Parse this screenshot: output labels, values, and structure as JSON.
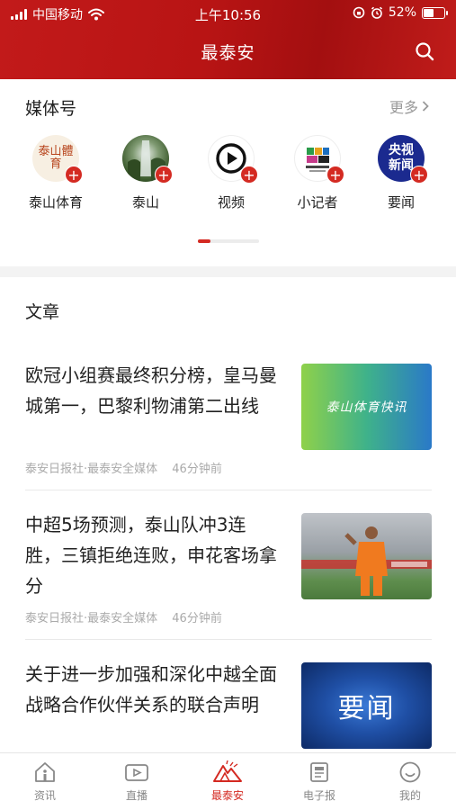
{
  "status_bar": {
    "carrier": "中国移动",
    "time": "上午10:56",
    "battery": "52%",
    "battery_level": 0.52
  },
  "header": {
    "title": "最泰安"
  },
  "media_section": {
    "title": "媒体号",
    "more_label": "更多",
    "items": [
      {
        "label": "泰山体育",
        "avatar_text": "泰山體育",
        "icon": "taishan-sports-logo"
      },
      {
        "label": "泰山",
        "avatar_text": "",
        "icon": "waterfall-photo"
      },
      {
        "label": "视频",
        "avatar_text": "",
        "icon": "play-icon"
      },
      {
        "label": "小记者",
        "avatar_text": "",
        "icon": "reporter-logo"
      },
      {
        "label": "要闻",
        "avatar_text": "央视新闻",
        "icon": "cctv-news-logo"
      }
    ],
    "pager_active_index": 0
  },
  "articles_section": {
    "title": "文章",
    "items": [
      {
        "headline": "欧冠小组赛最终积分榜，皇马曼城第一，巴黎利物浦第二出线",
        "source": "泰安日报社·最泰安全媒体",
        "time": "46分钟前",
        "thumb_text": "泰山体育快讯"
      },
      {
        "headline": "中超5场预测，泰山队冲3连胜，三镇拒绝连败，申花客场拿分",
        "source": "泰安日报社·最泰安全媒体",
        "time": "46分钟前",
        "thumb_text": ""
      },
      {
        "headline": "关于进一步加强和深化中越全面战略合作伙伴关系的联合声明",
        "source": "",
        "time": "",
        "thumb_text": "要闻"
      }
    ]
  },
  "tabbar": {
    "tabs": [
      {
        "label": "资讯",
        "icon": "home-icon"
      },
      {
        "label": "直播",
        "icon": "live-icon"
      },
      {
        "label": "最泰安",
        "icon": "mountain-icon"
      },
      {
        "label": "电子报",
        "icon": "newspaper-icon"
      },
      {
        "label": "我的",
        "icon": "profile-icon"
      }
    ],
    "active_index": 2
  },
  "colors": {
    "brand_red": "#c21a1a",
    "accent_red": "#d42a22"
  }
}
